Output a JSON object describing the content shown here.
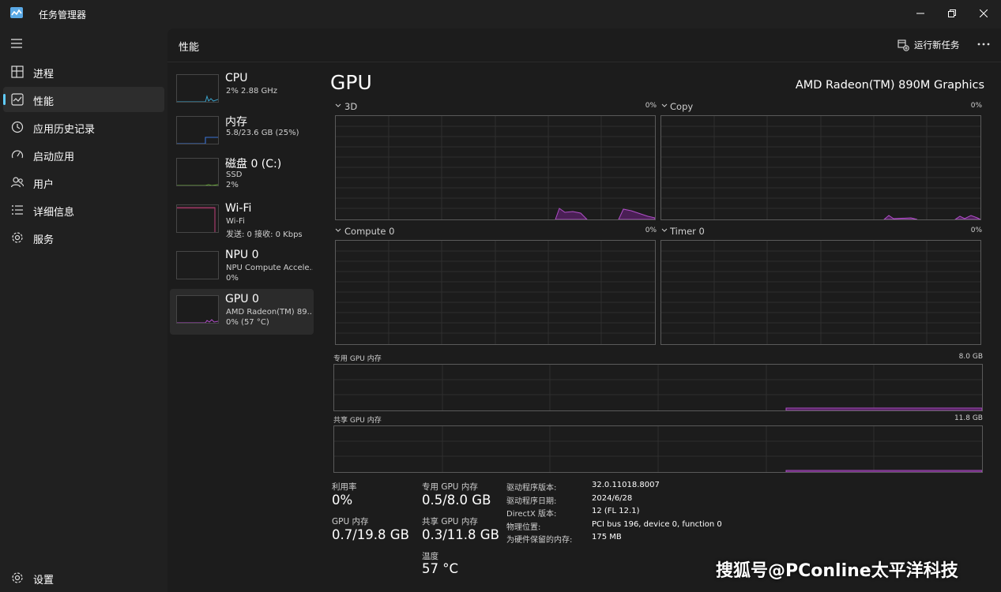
{
  "app": {
    "title": "任务管理器"
  },
  "nav": {
    "items": [
      {
        "label": "进程"
      },
      {
        "label": "性能"
      },
      {
        "label": "应用历史记录"
      },
      {
        "label": "启动应用"
      },
      {
        "label": "用户"
      },
      {
        "label": "详细信息"
      },
      {
        "label": "服务"
      }
    ],
    "settings": "设置"
  },
  "header": {
    "title": "性能",
    "run_task": "运行新任务"
  },
  "devices": [
    {
      "name": "CPU",
      "sub1": "2% 2.88 GHz",
      "sub2": ""
    },
    {
      "name": "内存",
      "sub1": "5.8/23.6 GB (25%)",
      "sub2": ""
    },
    {
      "name": "磁盘 0 (C:)",
      "sub1": "SSD",
      "sub2": "2%"
    },
    {
      "name": "Wi-Fi",
      "sub1": "Wi-Fi",
      "sub2": "发送: 0 接收: 0 Kbps"
    },
    {
      "name": "NPU 0",
      "sub1": "NPU Compute Accele...",
      "sub2": "0%"
    },
    {
      "name": "GPU 0",
      "sub1": "AMD Radeon(TM) 89...",
      "sub2": "0% (57 °C)"
    }
  ],
  "gpu": {
    "title": "GPU",
    "model": "AMD Radeon(TM) 890M Graphics",
    "engines": [
      {
        "label": "3D",
        "pct": "0%"
      },
      {
        "label": "Copy",
        "pct": "0%"
      },
      {
        "label": "Compute 0",
        "pct": "0%"
      },
      {
        "label": "Timer 0",
        "pct": "0%"
      }
    ],
    "dedicated": {
      "label": "专用 GPU 内存",
      "max": "8.0 GB"
    },
    "shared": {
      "label": "共享 GPU 内存",
      "max": "11.8 GB"
    },
    "stats": {
      "util_label": "利用率",
      "util_val": "0%",
      "gpu_mem_label": "GPU 内存",
      "gpu_mem_val": "0.7/19.8 GB",
      "ded_label": "专用 GPU 内存",
      "ded_val": "0.5/8.0 GB",
      "shared_label": "共享 GPU 内存",
      "shared_val": "0.3/11.8 GB",
      "temp_label": "温度",
      "temp_val": "57 °C"
    },
    "info": [
      {
        "k": "驱动程序版本:",
        "v": "32.0.11018.8007"
      },
      {
        "k": "驱动程序日期:",
        "v": "2024/6/28"
      },
      {
        "k": "DirectX 版本:",
        "v": "12 (FL 12.1)"
      },
      {
        "k": "物理位置:",
        "v": "PCI bus 196, device 0, function 0"
      },
      {
        "k": "为硬件保留的内存:",
        "v": "175 MB"
      }
    ]
  },
  "watermark": "搜狐号@PConline太平洋科技",
  "colors": {
    "accent": "#60cdff",
    "gpu_line": "#b04fc8",
    "cpu_line": "#3aa0c8",
    "mem_line": "#3a73d6"
  }
}
